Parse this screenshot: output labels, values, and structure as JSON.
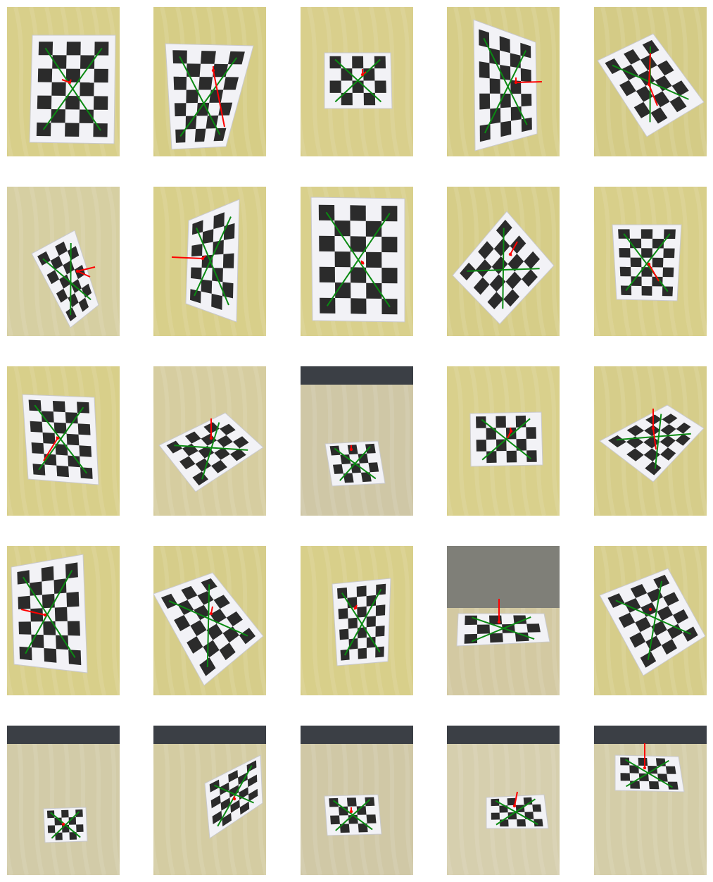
{
  "figure": {
    "rows": 5,
    "columns": 5,
    "panels": [
      {
        "scene": "table-close-portrait",
        "background": "#d8cf8a"
      },
      {
        "scene": "table-close-tilted",
        "background": "#d6cd86"
      },
      {
        "scene": "table-small-board",
        "background": "#d9cf8c"
      },
      {
        "scene": "table-close-skewed",
        "background": "#d6cd88"
      },
      {
        "scene": "table-oblique",
        "background": "#d4cb86"
      },
      {
        "scene": "table-oblique-edge",
        "background": "#d6cfa2"
      },
      {
        "scene": "table-perspective-left",
        "background": "#d8cf8a"
      },
      {
        "scene": "table-close-frontal",
        "background": "#d9d08c"
      },
      {
        "scene": "table-rotated",
        "background": "#d6cd88"
      },
      {
        "scene": "table-frontal-small",
        "background": "#d8cf8a"
      },
      {
        "scene": "table-close-tilted-2",
        "background": "#d8cf8a"
      },
      {
        "scene": "table-oblique-2",
        "background": "#d6cda0"
      },
      {
        "scene": "table-distant",
        "background": "#cfc7a6"
      },
      {
        "scene": "table-frontal-landscape",
        "background": "#d9d08c"
      },
      {
        "scene": "table-oblique-3",
        "background": "#d6cd8a"
      },
      {
        "scene": "table-close-folded",
        "background": "#d8cf8a"
      },
      {
        "scene": "table-oblique-4",
        "background": "#d6cd8a"
      },
      {
        "scene": "table-frontal-3",
        "background": "#d8cf8a"
      },
      {
        "scene": "table-with-hands",
        "background": "#d3c9a2"
      },
      {
        "scene": "table-rotated-2",
        "background": "#d6cd8a"
      },
      {
        "scene": "table-far",
        "background": "#d2cba8"
      },
      {
        "scene": "table-far-rotated",
        "background": "#d4cca2"
      },
      {
        "scene": "table-far-2",
        "background": "#d0c8a6"
      },
      {
        "scene": "table-far-chairs",
        "background": "#d6cfae"
      },
      {
        "scene": "table-far-3",
        "background": "#d4cda8"
      }
    ],
    "colors": {
      "paper": "#f2f2f6",
      "square": "#2b2b2b",
      "diagonal": "#0a8a12",
      "axis": "#ff0000"
    }
  }
}
